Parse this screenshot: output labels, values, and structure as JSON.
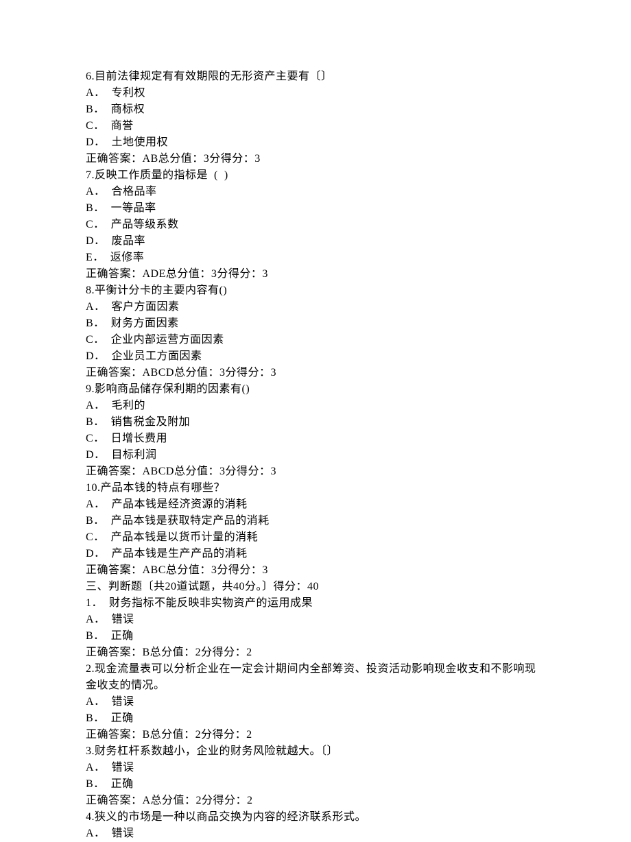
{
  "lines": [
    "6.目前法律规定有有效期限的无形资产主要有〔〕",
    "A．  专利权",
    "B．  商标权",
    "C．  商誉",
    "D．  土地使用权",
    "正确答案：AB总分值：3分得分：3",
    "7.反映工作质量的指标是  (  )",
    "A．  合格品率",
    "B．  一等品率",
    "C．  产品等级系数",
    "D．  废品率",
    "E．  返修率",
    "正确答案：ADE总分值：3分得分：3",
    "8.平衡计分卡的主要内容有()",
    "A．  客户方面因素",
    "B．  财务方面因素",
    "C．  企业内部运营方面因素",
    "D．  企业员工方面因素",
    "正确答案：ABCD总分值：3分得分：3",
    "9.影响商品储存保利期的因素有()",
    "A．  毛利的",
    "B．  销售税金及附加",
    "C．  日增长费用",
    "D．  目标利润",
    "正确答案：ABCD总分值：3分得分：3",
    "10.产品本钱的特点有哪些？",
    "A．  产品本钱是经济资源的消耗",
    "B．  产品本钱是获取特定产品的消耗",
    "C．  产品本钱是以货币计量的消耗",
    "D．  产品本钱是生产产品的消耗",
    "正确答案：ABC总分值：3分得分：3",
    "三、判断题〔共20道试题，共40分。〕得分：40",
    "1．  财务指标不能反映非实物资产的运用成果",
    "A．  错误",
    "B．  正确",
    "正确答案：B总分值：2分得分：2",
    "2.现金流量表可以分析企业在一定会计期间内全部筹资、投资活动影响现金收支和不影响现金收支的情况。",
    "A．  错误",
    "B．  正确",
    "正确答案：B总分值：2分得分：2",
    "3.财务杠杆系数越小，企业的财务风险就越大。〔〕",
    "A．  错误",
    "B．  正确",
    "正确答案：A总分值：2分得分：2",
    "4.狭义的市场是一种以商品交换为内容的经济联系形式。",
    "A．  错误"
  ]
}
